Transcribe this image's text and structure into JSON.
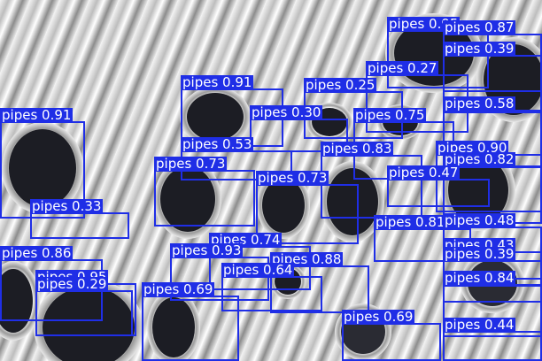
{
  "image": {
    "description_icon": "steel-pipes-photo",
    "box_color": "#1f2ee6",
    "label_text_color": "#ffffff"
  },
  "detections": [
    {
      "label": "pipes",
      "score": "0.95"
    },
    {
      "label": "pipes",
      "score": "0.87"
    },
    {
      "label": "pipes",
      "score": "0.39"
    },
    {
      "label": "pipes",
      "score": "0.27"
    },
    {
      "label": "pipes",
      "score": "0.91"
    },
    {
      "label": "pipes",
      "score": "0.25"
    },
    {
      "label": "pipes",
      "score": "0.91"
    },
    {
      "label": "pipes",
      "score": "0.30"
    },
    {
      "label": "pipes",
      "score": "0.75"
    },
    {
      "label": "pipes",
      "score": "0.58"
    },
    {
      "label": "pipes",
      "score": "0.53"
    },
    {
      "label": "pipes",
      "score": "0.83"
    },
    {
      "label": "pipes",
      "score": "0.90"
    },
    {
      "label": "pipes",
      "score": "0.82"
    },
    {
      "label": "pipes",
      "score": "0.73"
    },
    {
      "label": "pipes",
      "score": "0.73"
    },
    {
      "label": "pipes",
      "score": "0.47"
    },
    {
      "label": "pipes",
      "score": "0.33"
    },
    {
      "label": "pipes",
      "score": "0.81"
    },
    {
      "label": "pipes",
      "score": "0.48"
    },
    {
      "label": "pipes",
      "score": "0.74"
    },
    {
      "label": "pipes",
      "score": "0.43"
    },
    {
      "label": "pipes",
      "score": "0.86"
    },
    {
      "label": "pipes",
      "score": "0.93"
    },
    {
      "label": "pipes",
      "score": "0.88"
    },
    {
      "label": "pipes",
      "score": "0.39"
    },
    {
      "label": "pipes",
      "score": "0.64"
    },
    {
      "label": "pipes",
      "score": "0.95"
    },
    {
      "label": "pipes",
      "score": "0.29"
    },
    {
      "label": "pipes",
      "score": "0.69"
    },
    {
      "label": "pipes",
      "score": "0.84"
    },
    {
      "label": "pipes",
      "score": "0.69"
    },
    {
      "label": "pipes",
      "score": "0.44"
    }
  ]
}
